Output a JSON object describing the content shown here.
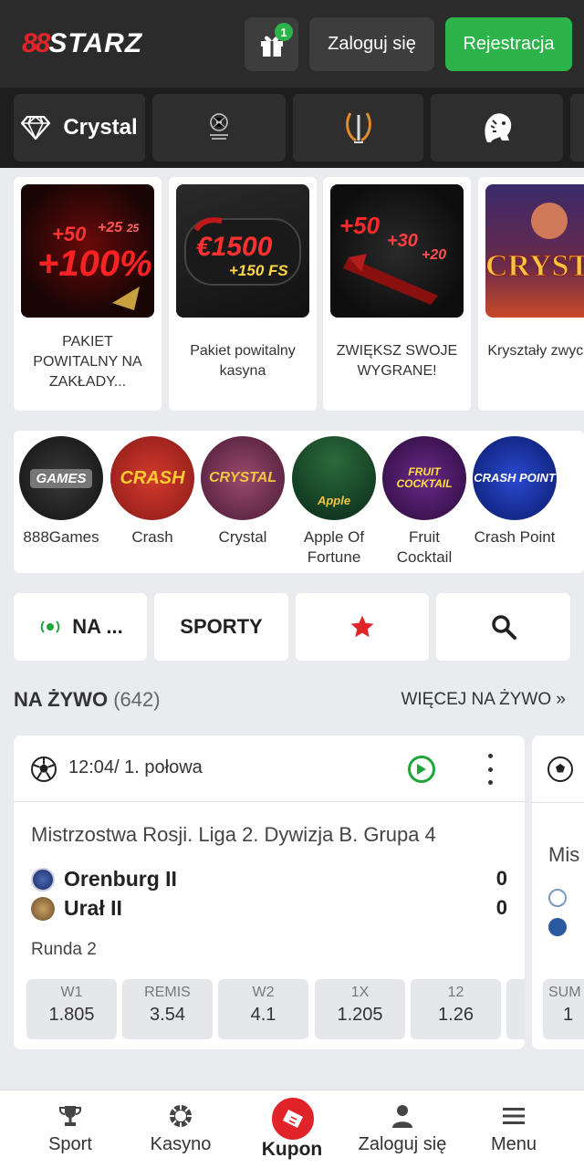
{
  "header": {
    "logo_mark": "88",
    "logo_text": "STARZ",
    "gift_badge": "1",
    "login_label": "Zaloguj się",
    "register_label": "Rejestracja",
    "accent": "#2cb34a",
    "brand_red": "#e0242a"
  },
  "categories": [
    {
      "label": "Crystal",
      "icon": "diamond-icon"
    },
    {
      "label": "",
      "icon": "champions-league-icon"
    },
    {
      "label": "",
      "icon": "europa-league-icon"
    },
    {
      "label": "",
      "icon": "premier-league-icon"
    }
  ],
  "promos": [
    {
      "title": "PAKIET POWITALNY NA ZAKŁADY...",
      "art": "+100%"
    },
    {
      "title": "Pakiet powitalny kasyna",
      "art": "€1500",
      "art2": "+150 FS"
    },
    {
      "title": "ZWIĘKSZ SWOJE WYGRANE!",
      "art": "+50 +30 +20"
    },
    {
      "title": "Kryształy zwycięstw",
      "art": "CRYSTAL"
    }
  ],
  "games": [
    {
      "label": "888Games",
      "art": "GAMES"
    },
    {
      "label": "Crash",
      "art": "CRASH"
    },
    {
      "label": "Crystal",
      "art": "CRYSTAL"
    },
    {
      "label": "Apple Of Fortune",
      "art": "Apple"
    },
    {
      "label": "Fruit Cocktail",
      "art": "FRUIT COCKTAIL"
    },
    {
      "label": "Crash Point",
      "art": "CRASH POINT"
    }
  ],
  "navrow": {
    "live_label": "NA ...",
    "sports_label": "SPORTY"
  },
  "live_section": {
    "title": "NA ŻYWO",
    "count": "(642)",
    "more": "WIĘCEJ NA ŻYWO »"
  },
  "match": {
    "time": "12:04",
    "period": "/ 1. połowa",
    "league": "Mistrzostwa Rosji. Liga 2. Dywizja B. Grupa 4",
    "team1": "Orenburg II",
    "score1": "0",
    "team2": "Urał II",
    "score2": "0",
    "round": "Runda 2",
    "odds": [
      {
        "label": "W1",
        "value": "1.805"
      },
      {
        "label": "REMIS",
        "value": "3.54"
      },
      {
        "label": "W2",
        "value": "4.1"
      },
      {
        "label": "1X",
        "value": "1.205"
      },
      {
        "label": "12",
        "value": "1.26"
      }
    ]
  },
  "match2": {
    "league_fragment": "Mis",
    "odd_label_fragment": "SUM",
    "odd_value_fragment": "1"
  },
  "bottom_nav": {
    "sport": "Sport",
    "casino": "Kasyno",
    "kupon": "Kupon",
    "login": "Zaloguj się",
    "menu": "Menu"
  }
}
